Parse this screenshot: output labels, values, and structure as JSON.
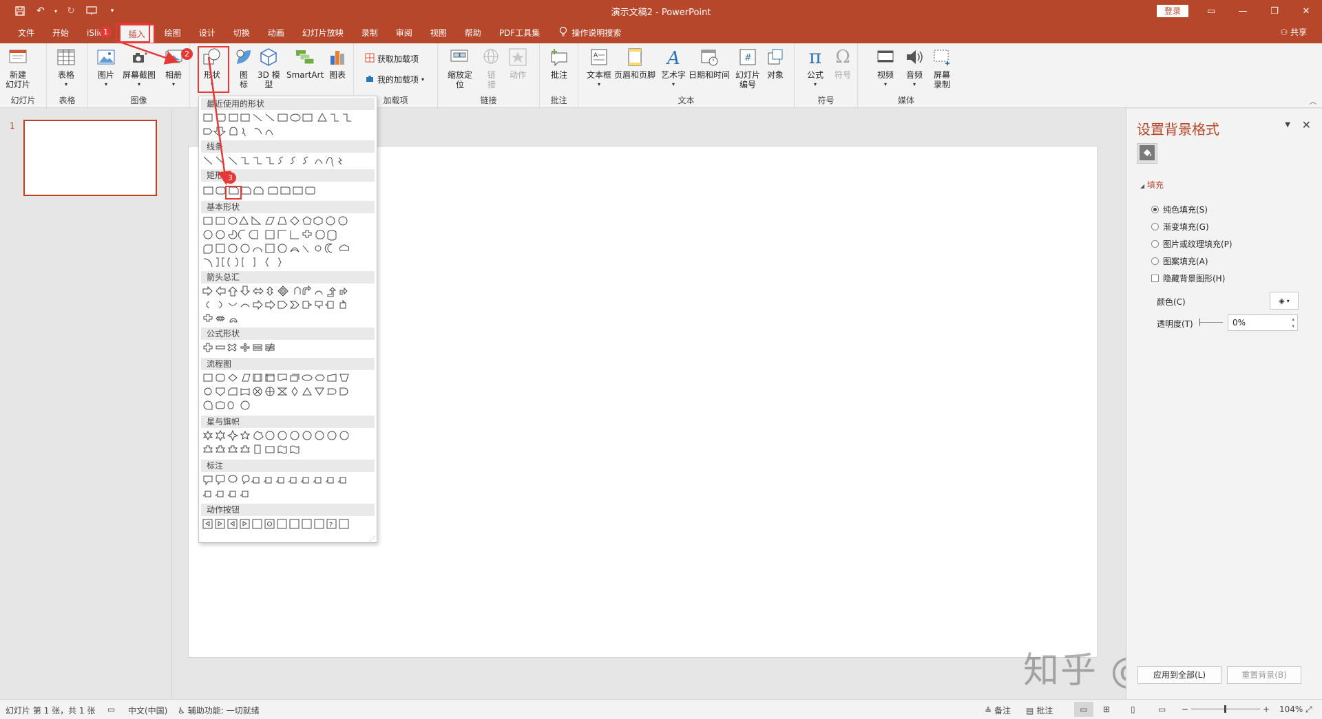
{
  "window": {
    "title": "演示文稿2  -  PowerPoint",
    "login_label": "登录",
    "share_label": "共享"
  },
  "tabs": [
    {
      "label": "文件"
    },
    {
      "label": "开始"
    },
    {
      "label": "iSlide"
    },
    {
      "label": "插入"
    },
    {
      "label": "绘图"
    },
    {
      "label": "设计"
    },
    {
      "label": "切换"
    },
    {
      "label": "动画"
    },
    {
      "label": "幻灯片放映"
    },
    {
      "label": "录制"
    },
    {
      "label": "审阅"
    },
    {
      "label": "视图"
    },
    {
      "label": "帮助"
    },
    {
      "label": "PDF工具集"
    }
  ],
  "tell_me": "操作说明搜索",
  "ribbon": {
    "groups": {
      "slides": "幻灯片",
      "tables": "表格",
      "images": "图像",
      "addins": "加载项",
      "links": "链接",
      "comments": "批注",
      "text": "文本",
      "symbols": "符号",
      "media": "媒体"
    },
    "buttons": {
      "new_slide": "新建\n幻灯片",
      "table": "表格",
      "pictures": "图片",
      "screenshot": "屏幕截图",
      "album": "相册",
      "shapes": "形状",
      "icons": "图\n标",
      "model3d": "3D 模\n型",
      "smartart": "SmartArt",
      "chart": "图表",
      "get_addins": "获取加载项",
      "my_addins": "我的加载项",
      "zoom": "缩放定\n位",
      "link": "链\n接",
      "action": "动作",
      "comment": "批注",
      "textbox": "文本框",
      "header_footer": "页眉和页脚",
      "wordart": "艺术字",
      "datetime": "日期和时间",
      "slide_number": "幻灯片\n编号",
      "object": "对象",
      "equation": "公式",
      "symbol": "符号",
      "video": "视频",
      "audio": "音频",
      "screen_recording": "屏幕\n录制"
    }
  },
  "shapes_menu": {
    "categories": {
      "recent": "最近使用的形状",
      "lines": "线条",
      "rectangles": "矩形",
      "basic": "基本形状",
      "arrows": "箭头总汇",
      "equation": "公式形状",
      "flowchart": "流程图",
      "stars": "星与旗帜",
      "callouts": "标注",
      "action_buttons": "动作按钮"
    }
  },
  "thumbnails": {
    "slide_number": "1"
  },
  "format_pane": {
    "title": "设置背景格式",
    "section": "填充",
    "options": [
      {
        "label": "纯色填充(S)",
        "selected": true
      },
      {
        "label": "渐变填充(G)",
        "selected": false
      },
      {
        "label": "图片或纹理填充(P)",
        "selected": false
      },
      {
        "label": "图案填充(A)",
        "selected": false
      }
    ],
    "hide_bg_graphics": "隐藏背景图形(H)",
    "color_label": "颜色(C)",
    "transparency_label": "透明度(T)",
    "transparency_value": "0%",
    "apply_all": "应用到全部(L)",
    "reset": "重置背景(B)"
  },
  "statusbar": {
    "slide_info": "幻灯片 第 1 张，共 1 张",
    "language": "中文(中国)",
    "accessibility": "辅助功能: 一切就绪",
    "notes": "备注",
    "comments": "批注",
    "zoom": "104%"
  },
  "annotations": {
    "badge1": "1",
    "badge2": "2",
    "badge3": "3"
  },
  "watermark": "知乎 @TW小白",
  "colors": {
    "accent": "#b7472a",
    "annotation_red": "#e53935"
  }
}
